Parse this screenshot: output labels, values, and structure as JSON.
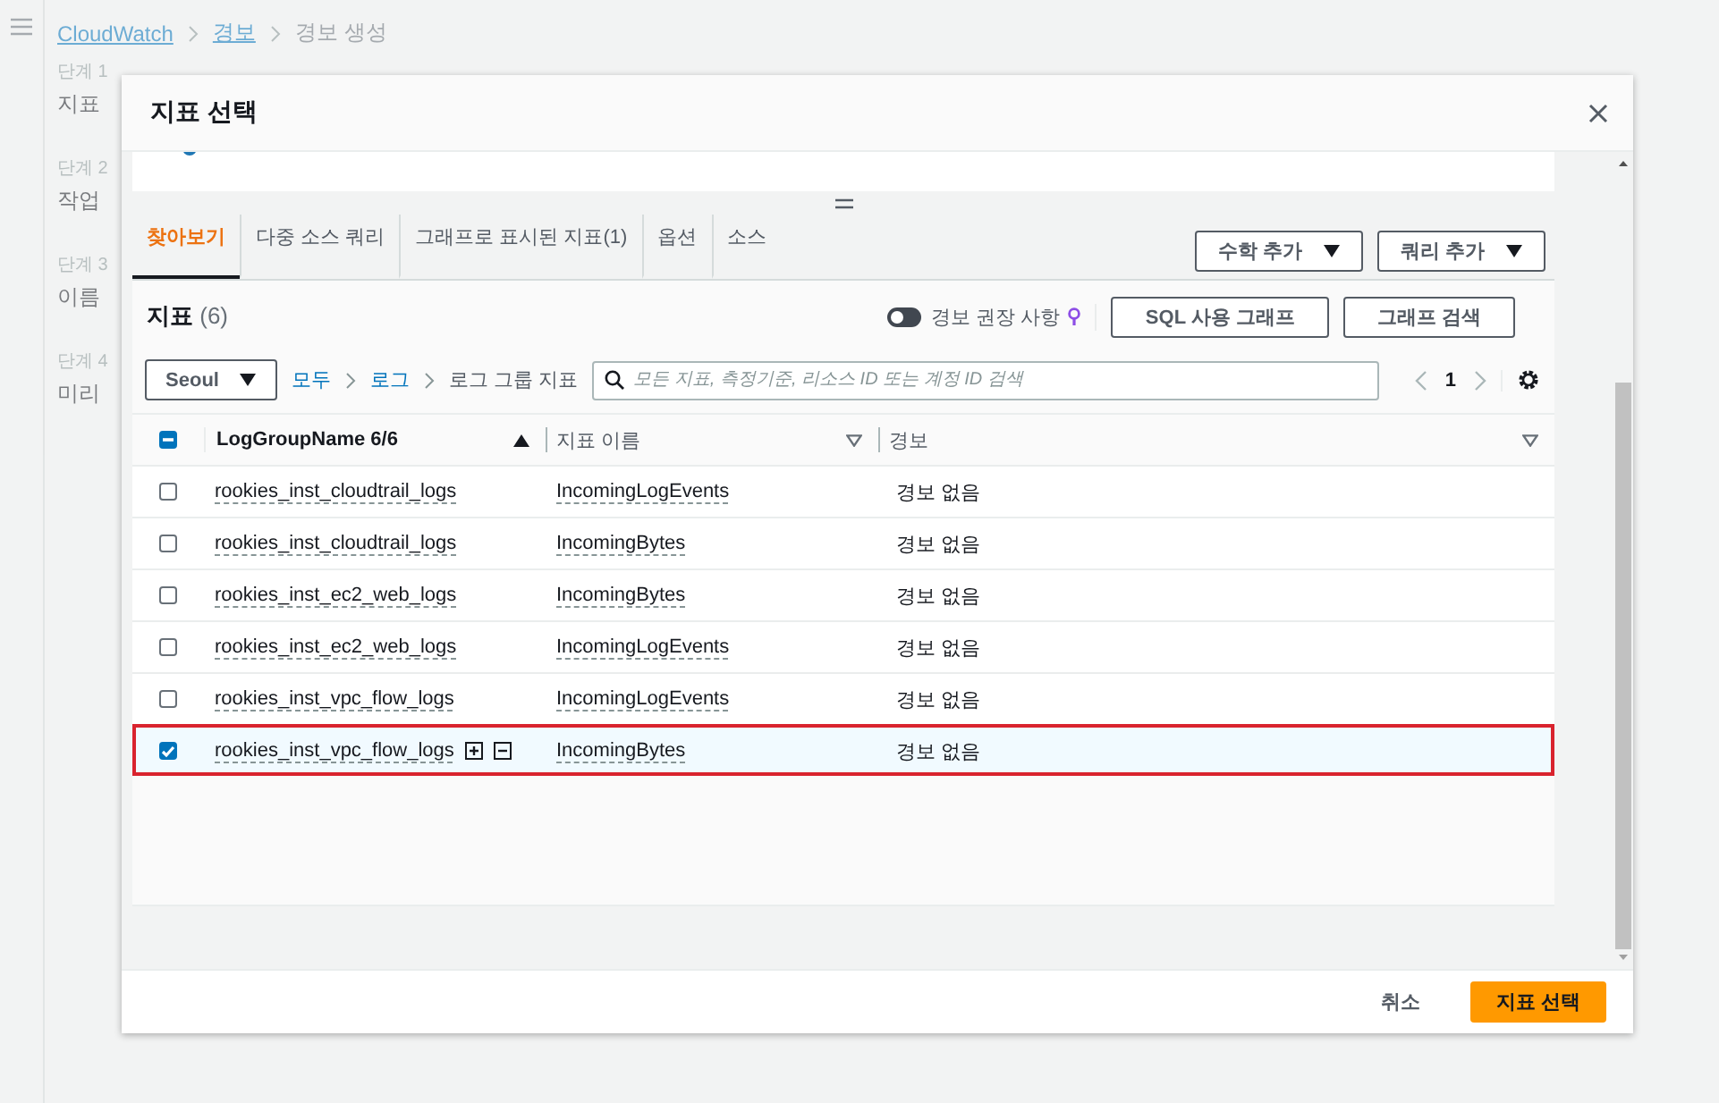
{
  "background": {
    "breadcrumbs": [
      {
        "label": "CloudWatch",
        "link": true
      },
      {
        "label": "경보",
        "link": true
      },
      {
        "label": "경보 생성",
        "link": false
      }
    ],
    "steps": [
      {
        "step": "단계 1",
        "label": "지표"
      },
      {
        "step": "단계 2",
        "label": "작업"
      },
      {
        "step": "단계 3",
        "label": "이름"
      },
      {
        "step": "단계 4",
        "label": "미리"
      }
    ]
  },
  "modal": {
    "title": "지표 선택",
    "legend": [
      {
        "color": "#1f77b4"
      }
    ],
    "tabs": [
      {
        "label": "찾아보기",
        "selected": true
      },
      {
        "label": "다중 소스 쿼리",
        "selected": false
      },
      {
        "label": "그래프로 표시된 지표(1)",
        "selected": false
      },
      {
        "label": "옵션",
        "selected": false
      },
      {
        "label": "소스",
        "selected": false
      }
    ],
    "tab_buttons": [
      "수학 추가",
      "쿼리 추가"
    ],
    "metrics": {
      "title": "지표",
      "count": "(6)",
      "toggle": {
        "label": "경보 권장 사항",
        "on": false
      },
      "buttons": [
        "SQL 사용 그래프",
        "그래프 검색"
      ],
      "region": "Seoul",
      "path": [
        {
          "label": "모두",
          "link": true
        },
        {
          "label": "로그",
          "link": true
        },
        {
          "label": "로그 그룹 지표",
          "link": false
        }
      ],
      "search": {
        "placeholder": "모든 지표, 측정기준, 리소스 ID 또는 계정 ID 검색"
      },
      "page": "1",
      "all_indeterminate": true,
      "columns": [
        {
          "label": "LogGroupName 6/6",
          "sorted": true
        },
        {
          "label": "지표 이름",
          "sorted": false
        },
        {
          "label": "경보",
          "sorted": false
        }
      ],
      "rows": [
        {
          "log_group": "rookies_inst_cloudtrail_logs",
          "metric": "IncomingLogEvents",
          "alarm": "경보 없음",
          "checked": false,
          "marked": false
        },
        {
          "log_group": "rookies_inst_cloudtrail_logs",
          "metric": "IncomingBytes",
          "alarm": "경보 없음",
          "checked": false,
          "marked": false
        },
        {
          "log_group": "rookies_inst_ec2_web_logs",
          "metric": "IncomingBytes",
          "alarm": "경보 없음",
          "checked": false,
          "marked": false
        },
        {
          "log_group": "rookies_inst_ec2_web_logs",
          "metric": "IncomingLogEvents",
          "alarm": "경보 없음",
          "checked": false,
          "marked": false
        },
        {
          "log_group": "rookies_inst_vpc_flow_logs",
          "metric": "IncomingLogEvents",
          "alarm": "경보 없음",
          "checked": false,
          "marked": false
        },
        {
          "log_group": "rookies_inst_vpc_flow_logs",
          "metric": "IncomingBytes",
          "alarm": "경보 없음",
          "checked": true,
          "marked": true
        }
      ]
    },
    "footer": {
      "cancel": "취소",
      "confirm": "지표 선택"
    }
  }
}
